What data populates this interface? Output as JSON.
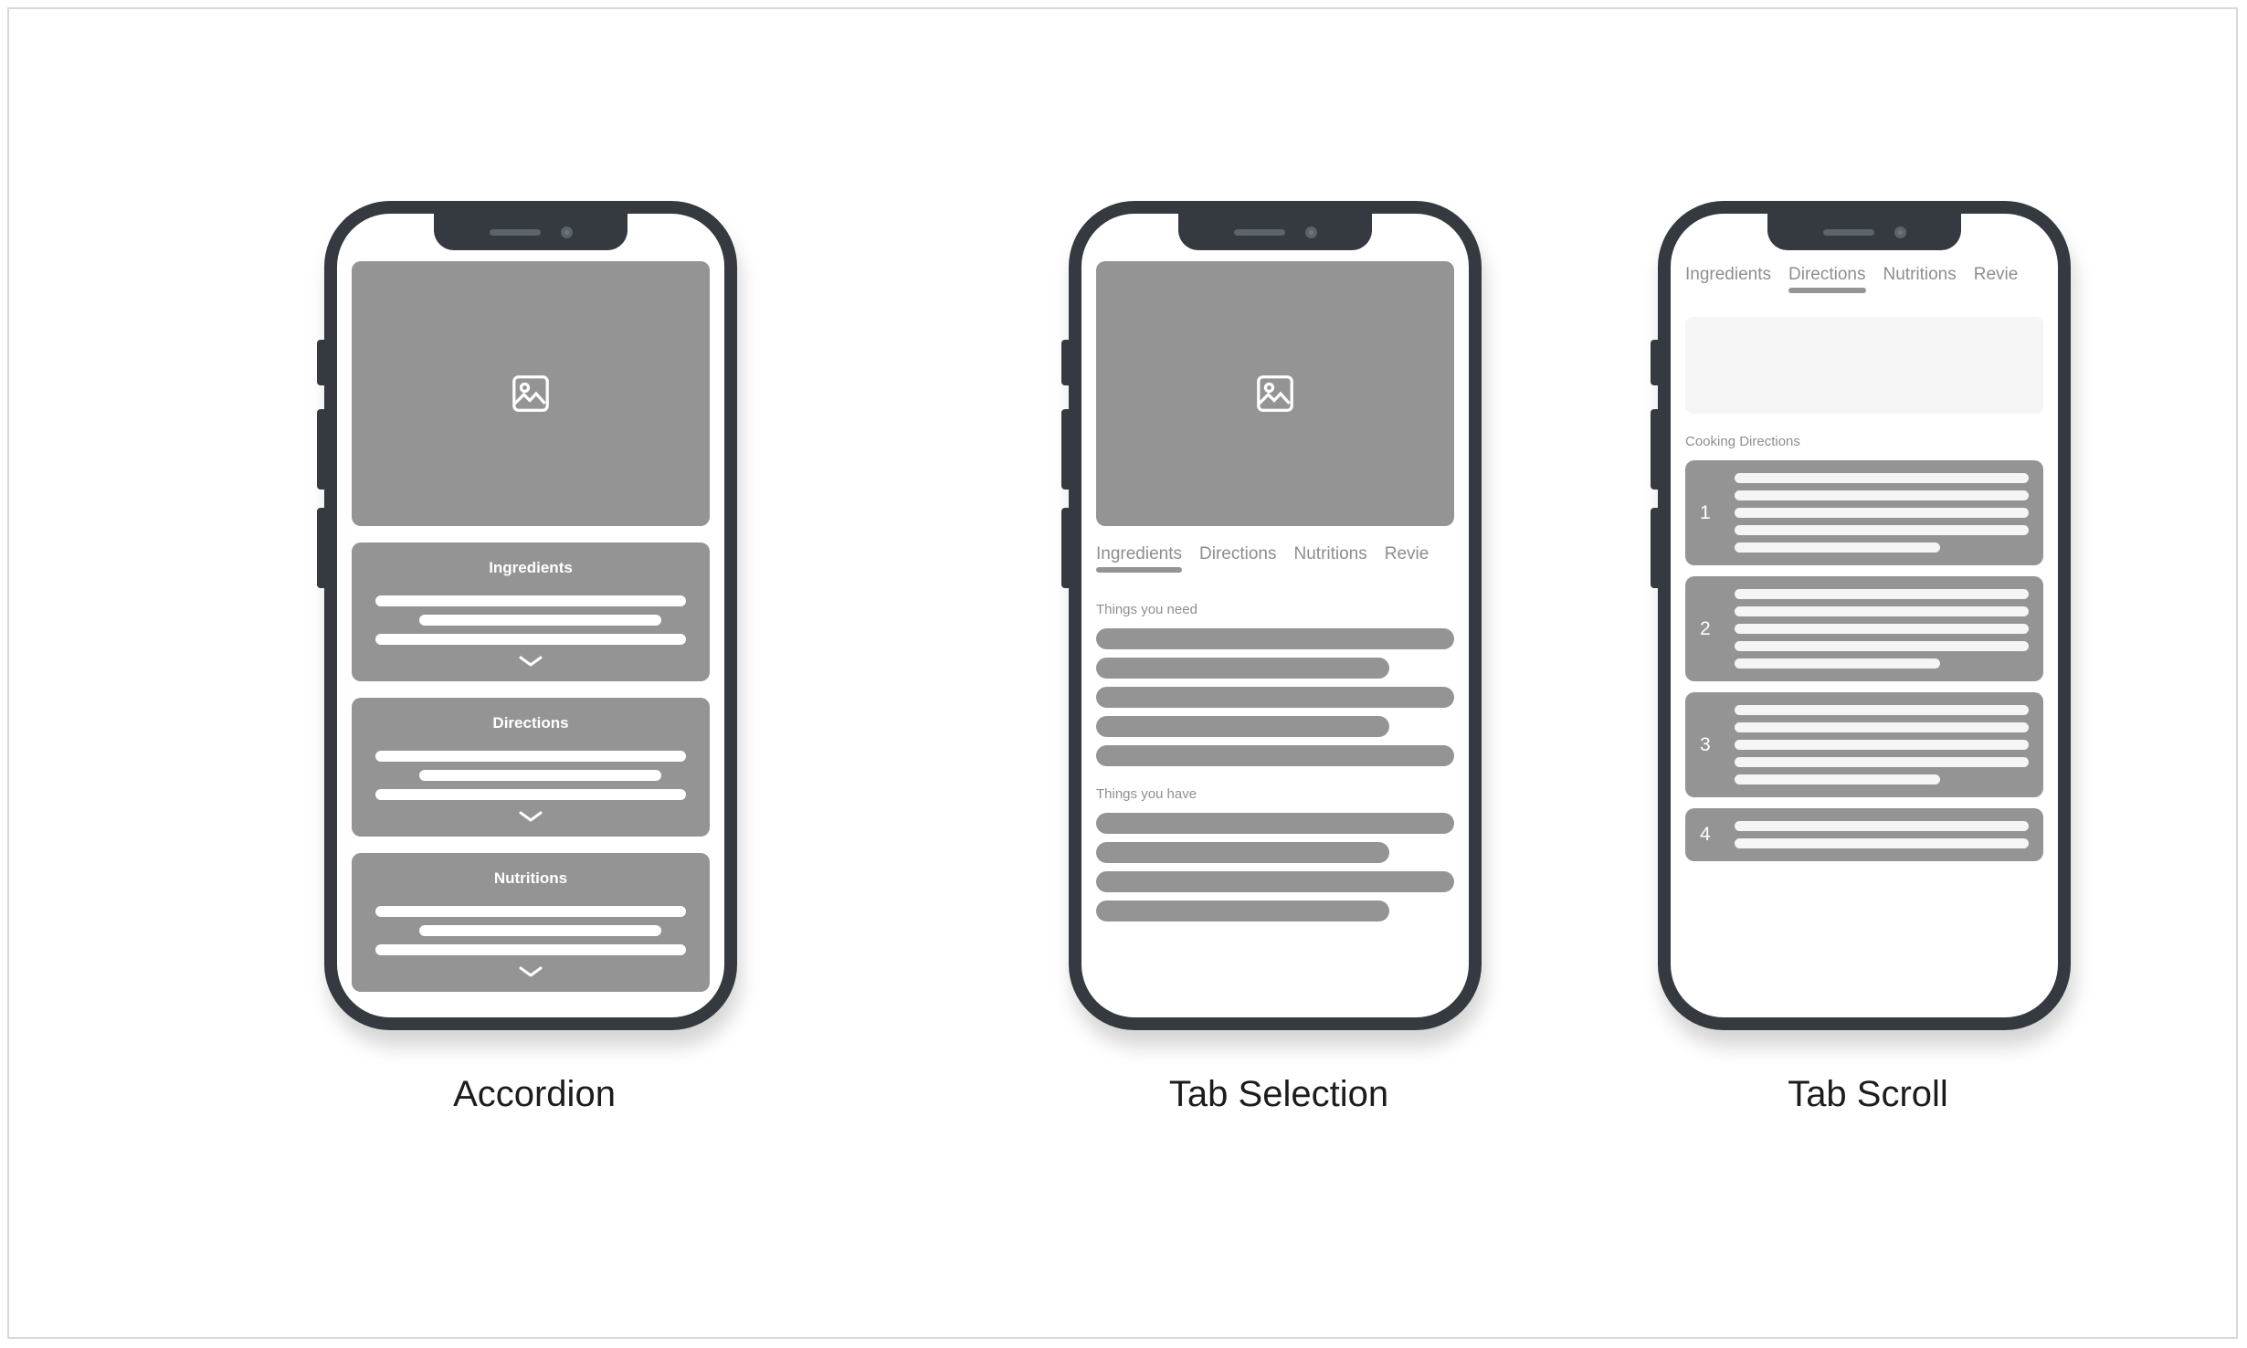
{
  "canvas": {
    "background": "#ffffff",
    "border_color": "#d9d9d9"
  },
  "palette": {
    "frame": "#343a40",
    "placeholder_gray": "#949494",
    "light_gray": "#f5f5f5",
    "text_gray": "#8e8e8e",
    "white": "#ffffff",
    "caption": "#1c1c1c"
  },
  "phones": [
    {
      "id": "accordion",
      "caption": "Accordion",
      "hero": {
        "icon": "image-placeholder-icon"
      },
      "accordions": [
        {
          "title": "Ingredients",
          "lines": [
            100,
            78,
            100
          ],
          "chevron": "chevron-down-icon"
        },
        {
          "title": "Directions",
          "lines": [
            100,
            78,
            100
          ],
          "chevron": "chevron-down-icon"
        },
        {
          "title": "Nutritions",
          "lines": [
            100,
            78,
            100
          ],
          "chevron": "chevron-down-icon"
        }
      ]
    },
    {
      "id": "tab-selection",
      "caption": "Tab Selection",
      "hero": {
        "icon": "image-placeholder-icon"
      },
      "tabs": [
        {
          "label": "Ingredients",
          "active": true
        },
        {
          "label": "Directions",
          "active": false
        },
        {
          "label": "Nutritions",
          "active": false
        },
        {
          "label": "Revie",
          "active": false
        }
      ],
      "sections": [
        {
          "label": "Things you need",
          "bars": [
            100,
            82,
            100,
            82,
            100
          ]
        },
        {
          "label": "Things you have",
          "bars": [
            100,
            82,
            100,
            82
          ]
        }
      ]
    },
    {
      "id": "tab-scroll",
      "caption": "Tab Scroll",
      "tabs": [
        {
          "label": "Ingredients",
          "active": false
        },
        {
          "label": "Directions",
          "active": true
        },
        {
          "label": "Nutritions",
          "active": false
        },
        {
          "label": "Revie",
          "active": false
        }
      ],
      "placeholder_box": true,
      "section_label": "Cooking Directions",
      "steps": [
        {
          "number": "1",
          "lines": [
            100,
            100,
            100,
            100,
            70
          ]
        },
        {
          "number": "2",
          "lines": [
            100,
            100,
            100,
            100,
            70
          ]
        },
        {
          "number": "3",
          "lines": [
            100,
            100,
            100,
            100,
            70
          ]
        },
        {
          "number": "4",
          "lines": [
            100,
            100
          ]
        }
      ]
    }
  ]
}
